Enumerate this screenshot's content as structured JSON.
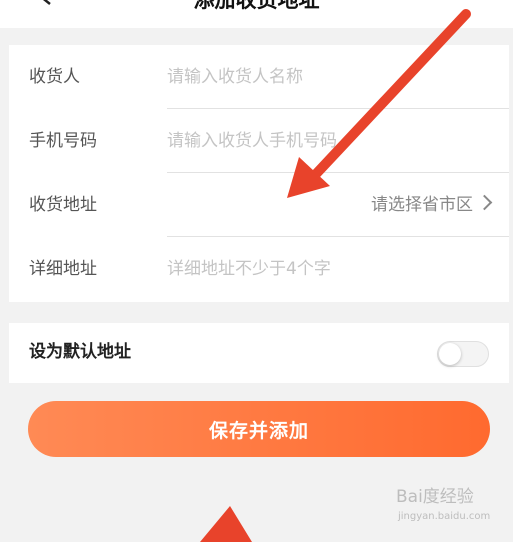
{
  "header": {
    "title": "添加收货地址",
    "back_icon": "chevron-left-icon"
  },
  "form": {
    "fields": [
      {
        "label": "收货人",
        "placeholder": "请输入收货人名称"
      },
      {
        "label": "手机号码",
        "placeholder": "请输入收货人手机号码"
      },
      {
        "label": "收货地址",
        "picker_text": "请选择省市区",
        "picker_icon": "chevron-right-icon"
      },
      {
        "label": "详细地址",
        "placeholder": "详细地址不少于4个字"
      }
    ]
  },
  "default_address": {
    "label": "设为默认地址",
    "enabled": false
  },
  "save_button": {
    "label": "保存并添加",
    "gradient_start": "#ff8a55",
    "gradient_end": "#ff6a2f"
  },
  "annotation": {
    "arrow_color": "#e8432b"
  },
  "watermark": {
    "logo_text": "Bai度经验",
    "sub_text": "jingyan.baidu.com"
  }
}
